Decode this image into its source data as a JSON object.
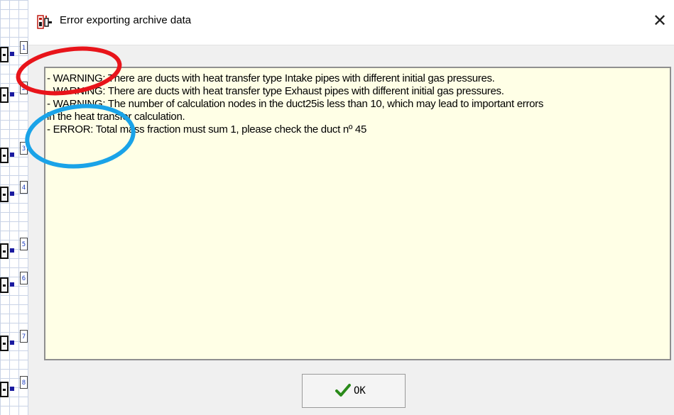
{
  "dialog": {
    "title": "Error exporting archive data",
    "close_icon": "close-icon",
    "app_icon": "app-logo-icon"
  },
  "messages": [
    "- WARNING: There are ducts with heat transfer type Intake pipes with different initial gas pressures.",
    "- WARNING: There are ducts with heat transfer type Exhaust pipes with different initial gas pressures.",
    "- WARNING: The number of calculation nodes in the duct25is less than 10, which may lead to important errors",
    "in the heat transfer calculation.",
    "- ERROR: Total mass fraction must sum 1, please check the duct nº 45"
  ],
  "ok_button": {
    "label": "OK",
    "icon": "checkmark-icon"
  },
  "background_nodes": [
    "1",
    "2",
    "3",
    "4",
    "5",
    "6",
    "7",
    "8"
  ],
  "colors": {
    "message_bg": "#ffffe6",
    "annotation_red": "#e8141a",
    "annotation_blue": "#1aa3e8",
    "checkmark": "#2a8a1a"
  }
}
